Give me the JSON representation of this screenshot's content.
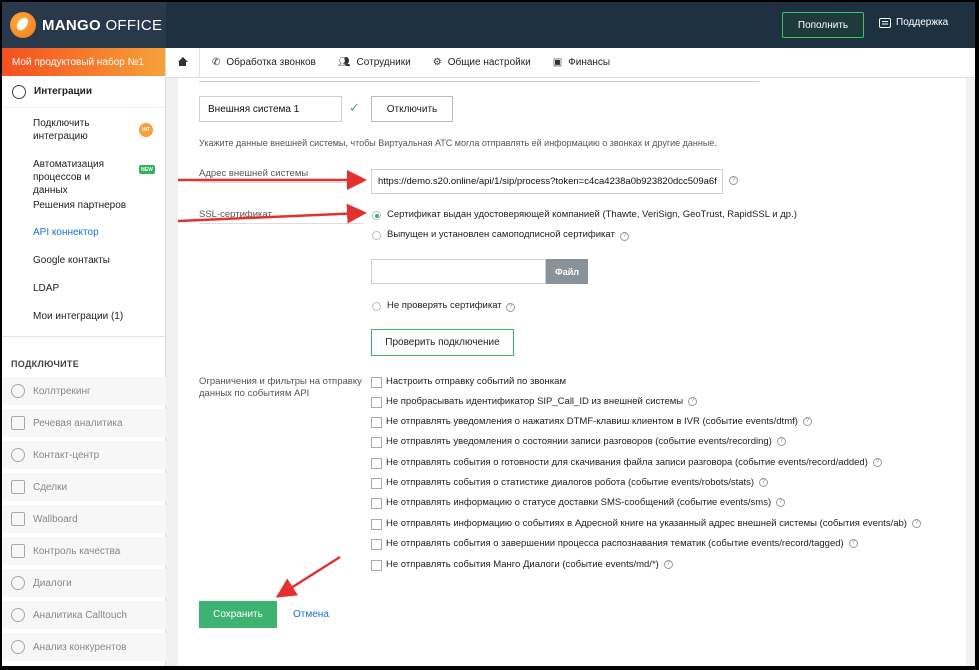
{
  "brand": {
    "logo_text_bold": "MANGO",
    "logo_text_light": " OFFICE"
  },
  "topbar": {
    "topup_label": "Пополнить",
    "support_label": "Поддержка"
  },
  "sidebar": {
    "product_set": "Мой продуктовый набор №1",
    "section_integrations": "Интеграции",
    "items": [
      {
        "label": "Подключить интеграцию",
        "badge": "HIT"
      },
      {
        "label": "Автоматизация процессов и данных",
        "badge": "NEW"
      },
      {
        "label": "Решения партнеров"
      },
      {
        "label": "API коннектор"
      },
      {
        "label": "Google контакты"
      },
      {
        "label": "LDAP"
      },
      {
        "label": "Мои интеграции (1)"
      }
    ],
    "connect_heading": "ПОДКЛЮЧИТЕ",
    "connect_items": [
      "Коллтрекинг",
      "Речевая аналитика",
      "Контакт-центр",
      "Сделки",
      "Wallboard",
      "Контроль качества",
      "Диалоги",
      "Аналитика Calltouch",
      "Анализ конкурентов"
    ]
  },
  "nav": {
    "tabs": [
      "Обработка звонков",
      "Сотрудники",
      "Общие настройки",
      "Финансы"
    ]
  },
  "form": {
    "system_name": "Внешняя система 1",
    "disable_label": "Отключить",
    "hint": "Укажите данные внешней системы, чтобы Виртуальная АТС могла отправлять ей информацию о звонках и другие данные.",
    "address_label": "Адрес внешней системы",
    "address_value": "https://demo.s20.online/api/1/sip/process?token=c4ca4238a0b923820dcc509a6f",
    "ssl_label": "SSL-сертификат",
    "ssl_options": [
      "Сертификат выдан удостоверяющей компанией (Thawte, VeriSign, GeoTrust, RapidSSL и др.)",
      "Выпущен и установлен самоподписной сертификат",
      "Не проверять сертификат"
    ],
    "file_label": "Файл",
    "verify_label": "Проверить подключение",
    "filters_label": "Ограничения и фильтры на отправку данных по событиям API",
    "filters": [
      "Настроить отправку событий по звонкам",
      "Не пробрасывать идентификатор SIP_Call_ID из внешней системы",
      "Не отправлять уведомления о нажатиях DTMF-клавиш клиентом в IVR (событие events/dtmf)",
      "Не отправлять уведомления о состоянии записи разговоров (событие events/recording)",
      "Не отправлять события о готовности для скачивания файла записи разговора (событие events/record/added)",
      "Не отправлять события о статистике диалогов робота (событие events/robots/stats)",
      "Не отправлять информацию о статусе доставки SMS-сообщений (событие events/sms)",
      "Не отправлять информацию о событиях в Адресной книге на указанный адрес внешней системы (события events/ab)",
      "Не отправлять события о завершении процесса распознавания тематик (событие events/record/tagged)",
      "Не отправлять события Манго Диалоги (событие events/md/*)"
    ],
    "save_label": "Сохранить",
    "cancel_label": "Отмена"
  },
  "colors": {
    "accent_green": "#3cb371",
    "link_blue": "#1a6fd6",
    "arrow_red": "#e53030",
    "topbar": "#1e3140"
  }
}
